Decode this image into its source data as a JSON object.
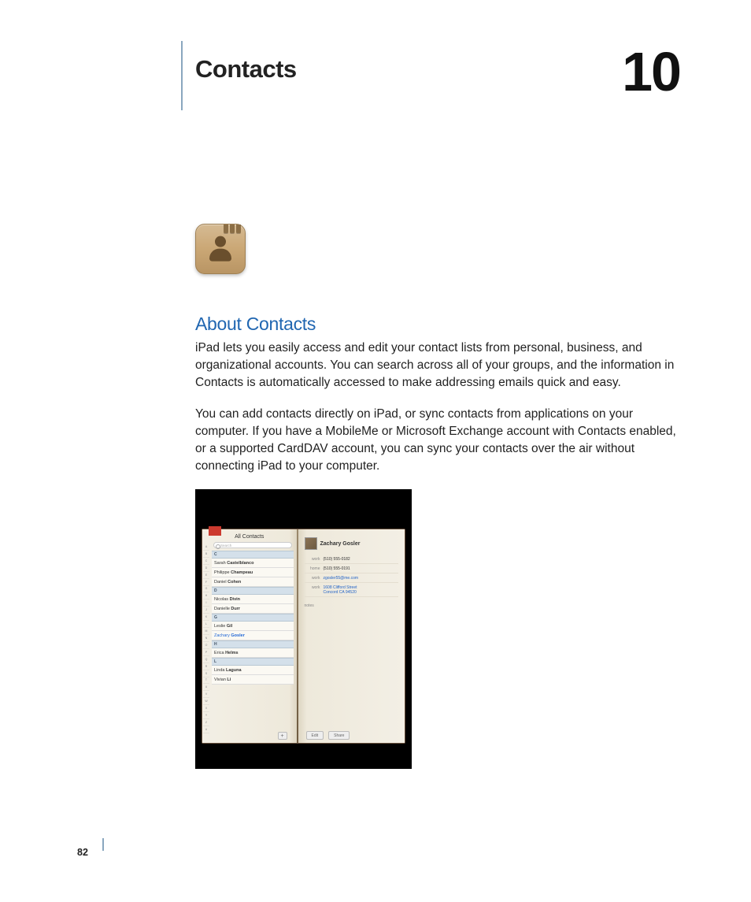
{
  "chapter": {
    "title": "Contacts",
    "number": "10"
  },
  "section": {
    "heading": "About Contacts"
  },
  "paragraphs": {
    "p1": "iPad lets you easily access and edit your contact lists from personal, business, and organizational accounts. You can search across all of your groups, and the information in Contacts is automatically accessed to make addressing emails quick and easy.",
    "p2": "You can add contacts directly on iPad, or sync contacts from applications on your computer. If you have a MobileMe or Microsoft Exchange account with Contacts enabled, or a supported CardDAV account, you can sync your contacts over the air without connecting iPad to your computer."
  },
  "pageNumber": "82",
  "screenshot": {
    "listTitle": "All Contacts",
    "searchPlaceholder": "Search",
    "indexLetters": [
      "A",
      "B",
      "C",
      "D",
      "E",
      "F",
      "G",
      "H",
      "I",
      "J",
      "K",
      "L",
      "M",
      "N",
      "O",
      "P",
      "Q",
      "R",
      "S",
      "T",
      "U",
      "V",
      "W",
      "X",
      "Y",
      "Z",
      "#"
    ],
    "sections": {
      "C": [
        {
          "first": "Sarah",
          "last": "Castelblanco"
        },
        {
          "first": "Philippe",
          "last": "Champeau"
        },
        {
          "first": "Daniel",
          "last": "Cohen"
        }
      ],
      "D": [
        {
          "first": "Nicolas",
          "last": "Divin"
        },
        {
          "first": "Danielle",
          "last": "Durr"
        }
      ],
      "G": [
        {
          "first": "Leslie",
          "last": "Gil"
        },
        {
          "first": "Zachary",
          "last": "Gosler",
          "selected": true
        }
      ],
      "H": [
        {
          "first": "Erica",
          "last": "Helms"
        }
      ],
      "L": [
        {
          "first": "Linda",
          "last": "Laguna"
        },
        {
          "first": "Vivian",
          "last": "Li"
        }
      ]
    },
    "addLabel": "+",
    "detail": {
      "name": "Zachary Gosler",
      "fields": [
        {
          "label": "work",
          "value": "(510) 555-0182",
          "type": "phone"
        },
        {
          "label": "home",
          "value": "(510) 555-0191",
          "type": "phone"
        },
        {
          "label": "work",
          "value": "zgosler55@me.com",
          "type": "link"
        },
        {
          "label": "work",
          "value": "1608 Clifford Street\nConcord CA 94520",
          "type": "link"
        }
      ],
      "notesLabel": "notes",
      "editLabel": "Edit",
      "shareLabel": "Share"
    }
  }
}
